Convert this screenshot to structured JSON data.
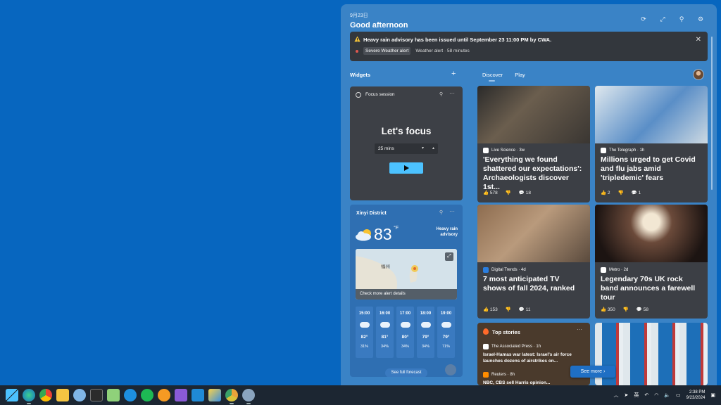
{
  "board": {
    "date": "9月23日",
    "greeting": "Good afternoon",
    "header_icons": [
      "refresh-icon",
      "expand-icon",
      "pin-icon",
      "gear-icon"
    ]
  },
  "alert": {
    "title": "Heavy rain advisory has been issued until September 23 11:00 PM by CWA.",
    "badge": "Severe Weather alert",
    "detail": "Weather alert · 58 minutes",
    "close": "✕"
  },
  "widgets": {
    "label": "Widgets",
    "add": "+"
  },
  "tabs": [
    {
      "label": "Discover"
    },
    {
      "label": "Play"
    }
  ],
  "focus": {
    "title": "Focus session",
    "heading": "Let's focus",
    "duration": "25 mins"
  },
  "weather": {
    "location": "Xinyi District",
    "temp": "83",
    "unit": "°F",
    "alert": "Heavy rain advisory",
    "map_label": "福州",
    "map_link": "Check more alert details",
    "hours": [
      {
        "time": "15:00",
        "temp": "82°",
        "precip": "31%"
      },
      {
        "time": "16:00",
        "temp": "81°",
        "precip": "34%"
      },
      {
        "time": "17:00",
        "temp": "80°",
        "precip": "34%"
      },
      {
        "time": "18:00",
        "temp": "79°",
        "precip": "34%"
      },
      {
        "time": "19:00",
        "temp": "79°",
        "precip": "71%"
      }
    ],
    "forecast_button": "See full forecast"
  },
  "news": [
    {
      "source": "Live Science · 3w",
      "headline": "'Everything we found shattered our expectations': Archaeologists discover 1st...",
      "likes": "578",
      "comments": "18"
    },
    {
      "source": "The Telegraph · 1h",
      "headline": "Millions urged to get Covid and flu jabs amid 'tripledemic' fears",
      "likes": "2",
      "comments": "1"
    },
    {
      "source": "Digital Trends · 4d",
      "headline": "7 most anticipated TV shows of fall 2024, ranked",
      "likes": "153",
      "comments": "11"
    },
    {
      "source": "Metro · 2d",
      "headline": "Legendary 70s UK rock band announces a farewell tour",
      "likes": "350",
      "comments": "58"
    }
  ],
  "top_stories": {
    "title": "Top stories",
    "items": [
      {
        "source": "The Associated Press · 1h",
        "headline": "Israel-Hamas war latest: Israel's air force launches dozens of airstrikes on..."
      },
      {
        "source": "Reuters · 8h",
        "headline": "NBC, CBS sell Harris opinion..."
      }
    ]
  },
  "see_more": "See more",
  "taskbar": {
    "apps": [
      "windows-start-icon",
      "edge-icon",
      "chrome-icon",
      "file-explorer-icon",
      "app-icon",
      "terminal-icon",
      "notepad-icon",
      "docker-icon",
      "spotify-icon",
      "search-tool-icon",
      "visual-studio-icon",
      "vscode-icon",
      "paint-icon",
      "chrome-canary-icon",
      "settings-icon"
    ],
    "ime": "英",
    "time": "2:38 PM",
    "date": "9/23/2024"
  },
  "colors": {
    "accent": "#4cc2ff",
    "board_bg": "#3a83c6",
    "card_bg": "#3c3f45",
    "desktop": "#0766bf",
    "taskbar": "#1c2632"
  }
}
